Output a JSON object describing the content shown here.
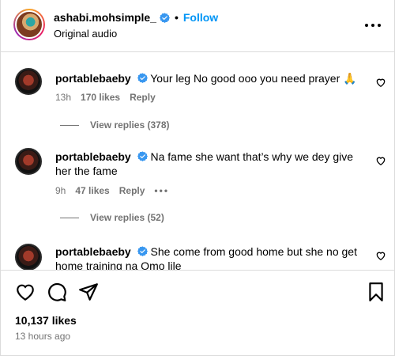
{
  "header": {
    "username": "ashabi.mohsimple_",
    "separator": "•",
    "follow_label": "Follow",
    "subtitle": "Original audio"
  },
  "comments": [
    {
      "username": "portablebaeby",
      "text": "Your leg No good ooo you need prayer 🙏",
      "time": "13h",
      "likes": "170 likes",
      "reply_label": "Reply",
      "view_replies": "View replies (378)"
    },
    {
      "username": "portablebaeby",
      "text": "Na fame she want that’s why we dey give her the fame",
      "time": "9h",
      "likes": "47 likes",
      "reply_label": "Reply",
      "more": "•••",
      "view_replies": "View replies (52)"
    },
    {
      "username": "portablebaeby",
      "text": "She come from good home but she no get home training na Omo lile"
    }
  ],
  "footer": {
    "likes_count": "10,137 likes",
    "time_ago": "13 hours ago"
  },
  "colors": {
    "accent": "#0095f6",
    "verified": "#3897f0",
    "muted": "#737373",
    "divider": "#dbdbdb"
  }
}
